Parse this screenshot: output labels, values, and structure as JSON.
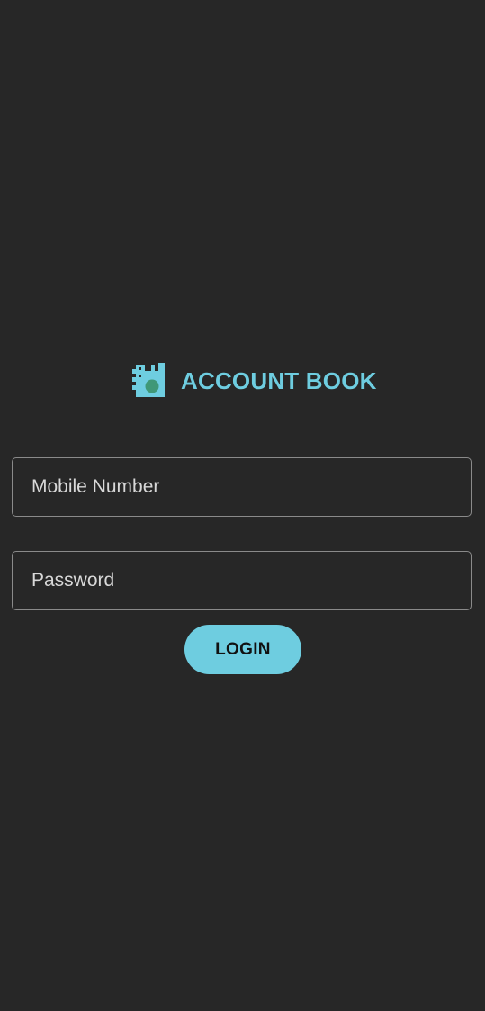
{
  "app": {
    "title": "ACCOUNT BOOK",
    "logo_icon": "account-book-logo-icon"
  },
  "login_form": {
    "mobile_placeholder": "Mobile Number",
    "mobile_value": "",
    "password_placeholder": "Password",
    "password_value": "",
    "login_label": "LOGIN"
  },
  "colors": {
    "background": "#272727",
    "accent": "#6ecde0",
    "field_border": "#8a8a8a",
    "placeholder_text": "#d8d8d8",
    "button_text": "#111111",
    "logo_dot": "#3f9877"
  }
}
